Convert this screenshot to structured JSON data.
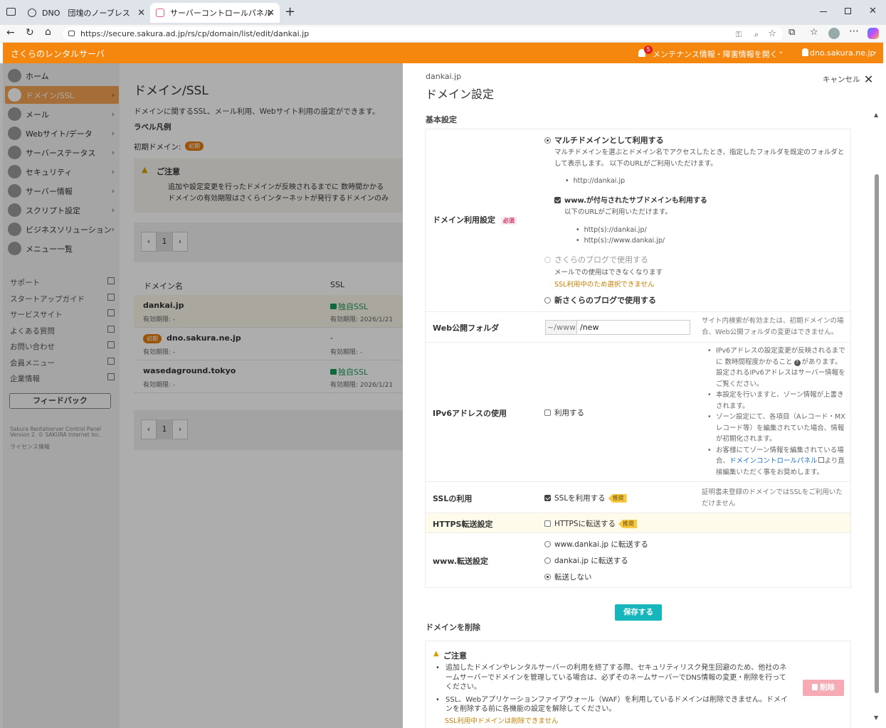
{
  "browser": {
    "tabs": [
      {
        "title": "DNO　団塊のノーブレス・オブリージュ"
      },
      {
        "title": "サーバーコントロールパネル"
      }
    ],
    "url": "https://secure.sakura.ad.jp/rs/cp/domain/list/edit/dankai.jp"
  },
  "header": {
    "brand": "さくらのレンタルサーバ",
    "notification_count": "5",
    "maintenance_label": "メンテナンス情報・障害情報を開く",
    "account": "dno.sakura.ne.jp"
  },
  "sidebar": {
    "items": [
      {
        "label": "ホーム"
      },
      {
        "label": "ドメイン/SSL"
      },
      {
        "label": "メール"
      },
      {
        "label": "Webサイト/データ"
      },
      {
        "label": "サーバーステータス"
      },
      {
        "label": "セキュリティ"
      },
      {
        "label": "サーバー情報"
      },
      {
        "label": "スクリプト設定"
      },
      {
        "label": "ビジネスソリューション"
      },
      {
        "label": "メニュー一覧"
      }
    ],
    "links": [
      {
        "label": "サポート"
      },
      {
        "label": "スタートアップガイド"
      },
      {
        "label": "サービスサイト"
      },
      {
        "label": "よくある質問"
      },
      {
        "label": "お問い合わせ"
      },
      {
        "label": "会員メニュー"
      },
      {
        "label": "企業情報"
      }
    ],
    "feedback": "フィードバック",
    "footer1": "Sakura Rentalserver Control Panel",
    "footer2": "Version 2. © SAKURA Internet Inc.",
    "license": "ライセンス情報"
  },
  "main": {
    "title": "ドメイン/SSL",
    "description": "ドメインに関するSSL、メール利用、Webサイト利用の設定ができます。",
    "legend_title": "ラベル凡例",
    "legend_initial": "初期ドメイン:",
    "initial_badge": "初期",
    "notice_title": "ご注意",
    "notice_items": [
      "追加や設定変更を行ったドメインが反映されるまでに 数時間かかる",
      "ドメインの有効期限はさくらインターネットが発行するドメインのみ"
    ],
    "page": "1",
    "col_domain": "ドメイン名",
    "col_ssl": "SSL",
    "rows": [
      {
        "domain": "dankai.jp",
        "expiry": "有効期限: -",
        "ssl": "独自SSL",
        "ssl_expiry": "有効期限: 2026/1/21"
      },
      {
        "domain": "dno.sakura.ne.jp",
        "expiry": "有効期限: -",
        "ssl": "-",
        "ssl_expiry": "有効期限: -"
      },
      {
        "domain": "wasedaground.tokyo",
        "expiry": "有効期限: -",
        "ssl": "独自SSL",
        "ssl_expiry": "有効期限: 2026/1/21"
      }
    ]
  },
  "panel": {
    "domain": "dankai.jp",
    "title": "ドメイン設定",
    "cancel": "キャンセル",
    "basic_section": "基本設定",
    "usage_label": "ドメイン利用設定",
    "required_badge": "必須",
    "opt_multi": "マルチドメインとして利用する",
    "opt_multi_desc": "マルチドメインを選ぶとドメイン名でアクセスしたとき、指定したフォルダを既定のフォルダとして表示します。 以下のURLがご利用いただけます。",
    "multi_url": "http://dankai.jp",
    "www_sub": "www.が付与されたサブドメインも利用する",
    "www_sub_desc": "以下のURLがご利用いただけます。",
    "www_urls": [
      "http(s)://dankai.jp/",
      "http(s)://www.dankai.jp/"
    ],
    "opt_blog": "さくらのブログで使用する",
    "opt_blog_desc": "メールでの使用はできなくなります",
    "opt_blog_warn": "SSL利用中のため選択できません",
    "opt_newblog": "新さくらのブログで使用する",
    "web_folder_label": "Web公開フォルダ",
    "folder_prefix": "~/www",
    "folder_value": "/new",
    "folder_note": "サイト内検索が有効または、初期ドメインの場合、Web公開フォルダの変更はできません。",
    "ipv6_label": "IPv6アドレスの使用",
    "ipv6_opt": "利用する",
    "ipv6_notes_1a": "IPv6アドレスの設定変更が反映されるまでに 数時間程度かかること",
    "ipv6_notes_1b": "があります。設定されるIPv6アドレスはサーバー情報をご覧ください。",
    "ipv6_notes_2": "本設定を行いますと、ゾーン情報が上書きされます。",
    "ipv6_notes_3": "ゾーン設定にて、各項目（Aレコード・MXレコード等）を編集されていた場合、情報が初期化されます。",
    "ipv6_notes_4a": "お客様にてゾーン情報を編集されている場合、",
    "ipv6_notes_4_link": "ドメインコントロールパネル",
    "ipv6_notes_4b": "より直接編集いただく事をお奨めします。",
    "ssl_label": "SSLの利用",
    "ssl_opt": "SSLを利用する",
    "recommended": "推奨",
    "ssl_note": "証明書未登録のドメインではSSLをご利用いただけません",
    "https_label": "HTTPS転送設定",
    "https_opt": "HTTPSに転送する",
    "www_redirect_label": "www.転送設定",
    "redirect_opts": [
      "www.dankai.jp に転送する",
      "dankai.jp に転送する",
      "転送しない"
    ],
    "save": "保存する",
    "delete_section": "ドメインを削除",
    "delete_notice_title": "ご注意",
    "delete_notice_1": "追加したドメインやレンタルサーバーの利用を終了する際、セキュリティリスク発生回避のため、他社のネームサーバーでドメインを管理している場合は、必ずそのネームサーバーでDNS情報の変更・削除を行ってください。",
    "delete_notice_2": "SSL、Webアプリケーションファイアウォール（WAF）を利用しているドメインは削除できません。ドメインを削除する前に各機能の設定を解除してください。",
    "delete_warn": "SSL利用中ドメインは削除できません",
    "delete_button": "削除"
  }
}
